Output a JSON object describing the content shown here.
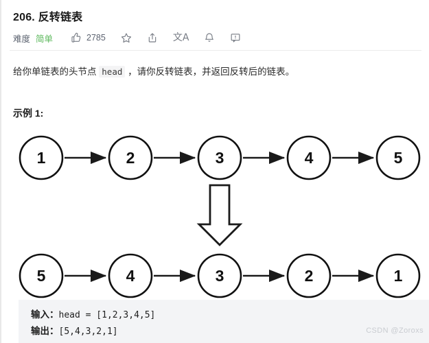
{
  "header": {
    "title": "206. 反转链表",
    "difficulty_label": "难度",
    "difficulty_value": "简单",
    "difficulty_color": "#5cb85c",
    "like_count": "2785",
    "icons": {
      "like": "thumbs-up-icon",
      "favorite": "star-icon",
      "share": "share-icon",
      "translate": "translate-icon",
      "translate_glyph": "文A",
      "notify": "bell-icon",
      "feedback": "feedback-icon"
    }
  },
  "description": {
    "before_code": "给你单链表的头节点",
    "code": "head",
    "after_code": "，请你反转链表，并返回反转后的链表。"
  },
  "example": {
    "heading": "示例 1:",
    "input_label": "输入：",
    "input_value": "head = [1,2,3,4,5]",
    "output_label": "输出：",
    "output_value": "[5,4,3,2,1]"
  },
  "diagram": {
    "top_row": [
      "1",
      "2",
      "3",
      "4",
      "5"
    ],
    "bottom_row": [
      "5",
      "4",
      "3",
      "2",
      "1"
    ],
    "node_stroke": "#111111",
    "node_fill": "#ffffff",
    "arrow_color": "#1a1a1a",
    "transform_arrow": "down-block-arrow"
  },
  "watermark": "CSDN @Zoroxs"
}
